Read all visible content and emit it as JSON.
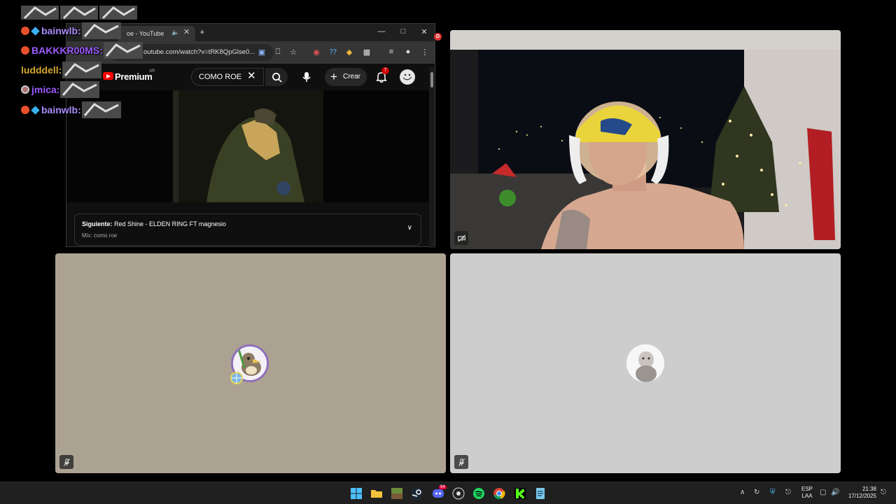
{
  "chat": {
    "messages": [
      {
        "user": "bainwlb:",
        "color": "#a78bfa"
      },
      {
        "user": "BAKKKR00MS:",
        "color": "#9b59ff"
      },
      {
        "user": "ludddell:",
        "color": "#d2a830"
      },
      {
        "user": "jmica:",
        "color": "#9b59ff"
      },
      {
        "user": "bainwlb:",
        "color": "#a78bfa"
      }
    ]
  },
  "browser": {
    "tab_title": "oe - YouTube",
    "url": "outube.com/watch?v=tRK8QpGlse0...",
    "notif_badge": "D"
  },
  "youtube": {
    "logo_text": "Premium",
    "region": "AR",
    "search_value": "COMO ROE",
    "create_label": "Crear",
    "notif_count": "7",
    "up_next_label": "Siguiente:",
    "up_next_title": "Red Shine - ELDEN RING FT magnesio",
    "up_next_mix": "Mix: como roe"
  },
  "taskbar": {
    "lang_top": "ESP",
    "lang_bottom": "LAA",
    "time": "21:38",
    "date": "17/12/2025",
    "discord_badge": "94"
  },
  "colors": {
    "tile_tan": "#aca292",
    "tile_gray": "#cdcdcd",
    "youtube_red": "#ff0000"
  }
}
